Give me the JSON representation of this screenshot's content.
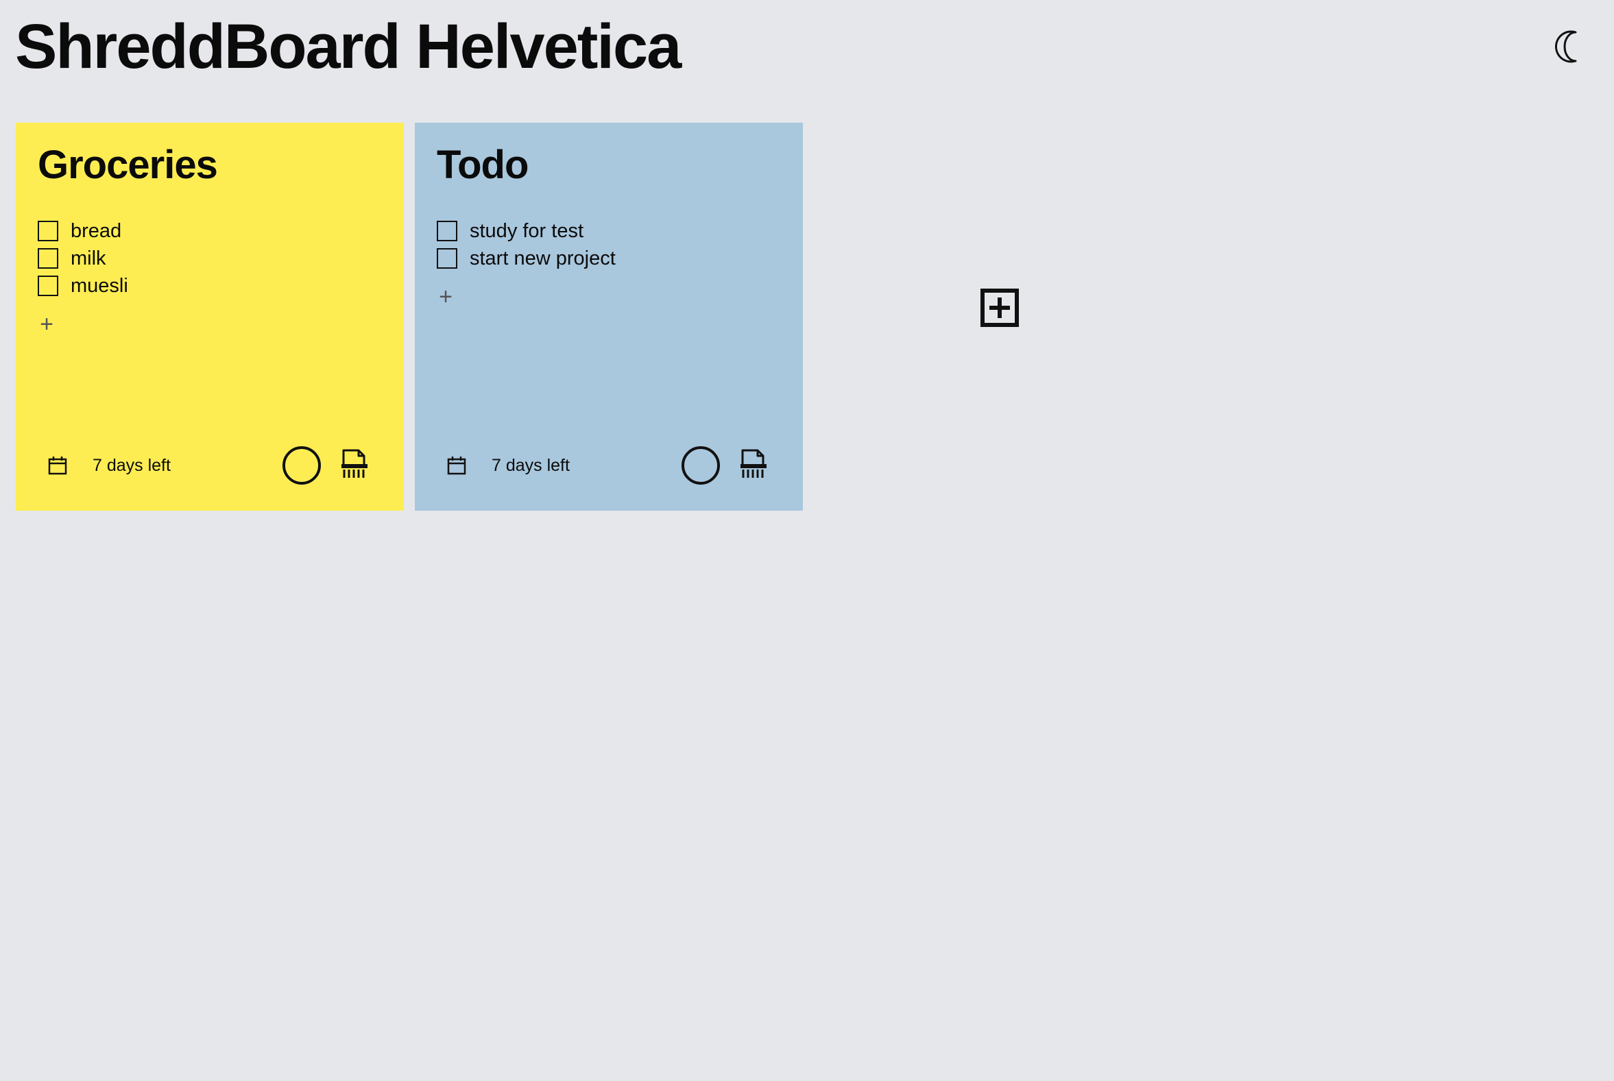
{
  "header": {
    "title": "ShreddBoard Helvetica",
    "theme_icon": "moon-icon"
  },
  "notes": [
    {
      "title": "Groceries",
      "color": "#feed52",
      "items": [
        {
          "label": "bread",
          "checked": false
        },
        {
          "label": "milk",
          "checked": false
        },
        {
          "label": "muesli",
          "checked": false
        }
      ],
      "add_item_label": "+",
      "days_left": "7 days left"
    },
    {
      "title": "Todo",
      "color": "#a9c7dd",
      "items": [
        {
          "label": "study for test",
          "checked": false
        },
        {
          "label": "start new project",
          "checked": false
        }
      ],
      "add_item_label": "+",
      "days_left": "7 days left"
    }
  ],
  "colors": {
    "background": "#e6e7eb",
    "text": "#0b0b0b"
  },
  "icons": {
    "calendar": "calendar-icon",
    "color_picker": "circle-icon",
    "shred": "shredder-icon",
    "add_note": "plus-square-icon"
  }
}
